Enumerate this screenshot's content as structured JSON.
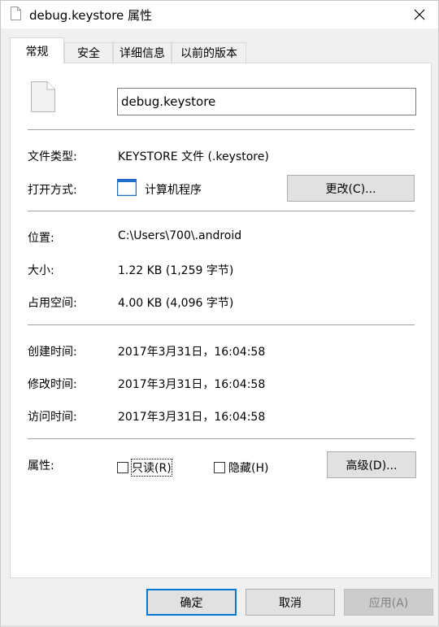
{
  "window": {
    "title": "debug.keystore 属性",
    "close_icon": "close-icon"
  },
  "tabs": [
    {
      "label": "常规",
      "active": true
    },
    {
      "label": "安全",
      "active": false
    },
    {
      "label": "详细信息",
      "active": false
    },
    {
      "label": "以前的版本",
      "active": false
    }
  ],
  "general": {
    "file_name": "debug.keystore",
    "type_label": "文件类型:",
    "type_value": "KEYSTORE 文件 (.keystore)",
    "opens_label": "打开方式:",
    "opens_value": "计算机程序",
    "change_button": "更改(C)...",
    "location_label": "位置:",
    "location_value": "C:\\Users\\700\\.android",
    "size_label": "大小:",
    "size_value": "1.22 KB (1,259 字节)",
    "disk_label": "占用空间:",
    "disk_value": "4.00 KB (4,096 字节)",
    "created_label": "创建时间:",
    "created_value": "2017年3月31日，16:04:58",
    "modified_label": "修改时间:",
    "modified_value": "2017年3月31日，16:04:58",
    "accessed_label": "访问时间:",
    "accessed_value": "2017年3月31日，16:04:58",
    "attributes_label": "属性:",
    "readonly_label": "只读(R)",
    "hidden_label": "隐藏(H)",
    "advanced_button": "高级(D)..."
  },
  "footer": {
    "ok": "确定",
    "cancel": "取消",
    "apply": "应用(A)"
  },
  "colors": {
    "accent": "#0078d7",
    "panel": "#ffffff",
    "chrome": "#f0f0f0"
  }
}
